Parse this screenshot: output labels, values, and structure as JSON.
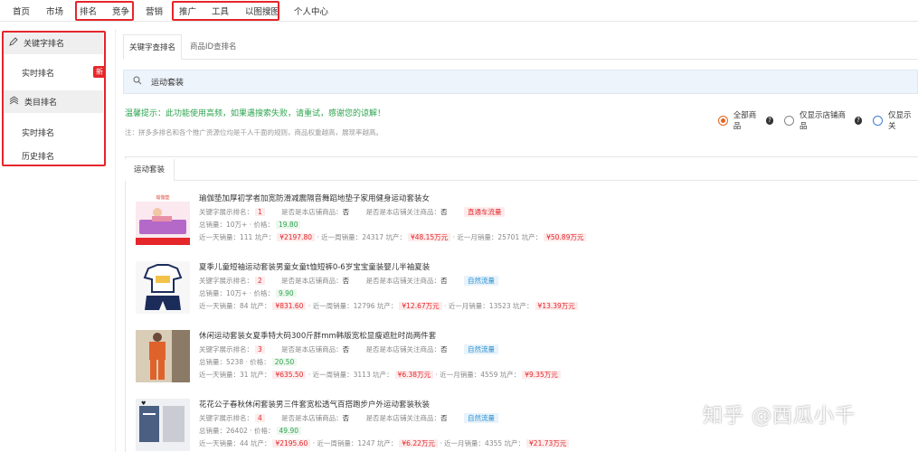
{
  "topnav": {
    "items": [
      "首页",
      "市场",
      "排名",
      "竞争",
      "营销",
      "推广",
      "工具",
      "以图搜图",
      "个人中心"
    ]
  },
  "sidebar": {
    "keyword_section": "关键字排名",
    "realtime": "实时排名",
    "new_badge": "新",
    "category_section": "类目排名",
    "cat_realtime": "实时排名",
    "cat_history": "历史排名"
  },
  "tabs": [
    "关键字查排名",
    "商品ID查排名"
  ],
  "search": {
    "value": "运动套装"
  },
  "warning": "温馨提示：此功能使用高频，如果遇搜索失败，请重试，感谢您的谅解！",
  "note": "注：拼多多排名和各个推广资源位均是千人千面的规则，商品权重越高，展现率越高。",
  "filters": {
    "all": "全部商品",
    "store_only": "仅显示店铺商品",
    "follow_only": "仅显示关"
  },
  "result_tab": "运动套装",
  "labels": {
    "rank": "关键字展示排名：",
    "is_store": "是否是本店铺商品：",
    "is_follow": "是否是本店铺关注商品：",
    "total_sales": "总销量：",
    "price": "· 价格：",
    "day_sales": "近一天销量：",
    "week_sales": "· 近一周销量：",
    "month_sales": "· 近一月销量：",
    "output": "坑产："
  },
  "products": [
    {
      "title": "瑜伽垫加厚初学者加宽防滑减震隔音舞蹈地垫子家用健身运动套装女",
      "rank": "1",
      "is_store": "否",
      "is_follow": "否",
      "tag": "直通车流量",
      "tag_type": "red",
      "total_sales": "10万+",
      "price": "19.80",
      "day_sales": "111",
      "day_output": "¥2197.80",
      "week_sales": "24317",
      "week_output": "¥48.15万元",
      "month_sales": "25701",
      "month_output": "¥50.89万元"
    },
    {
      "title": "夏季儿童短袖运动套装男童女童t恤短裤0-6岁宝宝童装婴儿半袖夏装",
      "rank": "2",
      "is_store": "否",
      "is_follow": "否",
      "tag": "自然流量",
      "tag_type": "blue",
      "total_sales": "10万+",
      "price": "9.90",
      "day_sales": "84",
      "day_output": "¥831.60",
      "week_sales": "12796",
      "week_output": "¥12.67万元",
      "month_sales": "13523",
      "month_output": "¥13.39万元"
    },
    {
      "title": "休闲运动套装女夏季特大码300斤胖mm韩版宽松显瘦遮肚时尚两件套",
      "rank": "3",
      "is_store": "否",
      "is_follow": "否",
      "tag": "自然流量",
      "tag_type": "blue",
      "total_sales": "5238",
      "price": "20.50",
      "day_sales": "31",
      "day_output": "¥635.50",
      "week_sales": "3113",
      "week_output": "¥6.38万元",
      "month_sales": "4559",
      "month_output": "¥9.35万元"
    },
    {
      "title": "花花公子春秋休闲套装男三件套宽松透气百搭跑步户外运动套装秋装",
      "rank": "4",
      "is_store": "否",
      "is_follow": "否",
      "tag": "自然流量",
      "tag_type": "blue",
      "total_sales": "26402",
      "price": "49.90",
      "day_sales": "44",
      "day_output": "¥2195.60",
      "week_sales": "1247",
      "week_output": "¥6.22万元",
      "month_sales": "4355",
      "month_output": "¥21.73万元"
    }
  ],
  "watermark": "知乎 @西瓜小千"
}
